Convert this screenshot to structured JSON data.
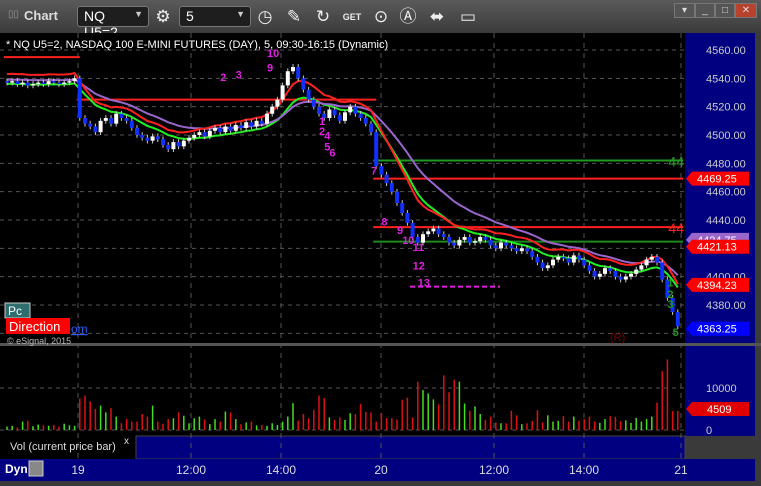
{
  "window": {
    "title": "Chart",
    "symbol": "NQ U5=2",
    "interval": "5"
  },
  "chart_header": "* NQ U5=2, NASDAQ 100 E-MINI FUTURES (DAY), 5, 09:30-16:15 (Dynamic)",
  "toolbar_icons": [
    "settings-icon",
    "clock-icon",
    "pencil-icon",
    "study-icon",
    "get-icon",
    "play-icon",
    "alert-icon",
    "link-icon",
    "comment-icon"
  ],
  "price_axis": {
    "ticks": [
      "4560.00",
      "4540.00",
      "4520.00",
      "4500.00",
      "4480.00",
      "4460.00",
      "4440.00",
      "4400.00",
      "4380.00"
    ],
    "markers": [
      {
        "text": "4469.25",
        "color": "#ff0000"
      },
      {
        "text": "4424.75",
        "color": "#9966cc"
      },
      {
        "text": "4421.13",
        "color": "#ff0000"
      },
      {
        "text": "4394.23",
        "color": "#ff0000"
      },
      {
        "text": "4363.25",
        "color": "#0000ff"
      }
    ]
  },
  "level_labels": [
    {
      "text": "44",
      "color": "#2a9a2a"
    },
    {
      "text": "44",
      "color": "#ff2020"
    }
  ],
  "overlay": {
    "pc": "Pc",
    "direction": "Direction",
    "om": "om",
    "copyright": "© eSignal, 2015",
    "r_marker": "(R)"
  },
  "volume": {
    "ticks": [
      "10000",
      "0"
    ],
    "marker": "4509",
    "panel_label": "Vol (current price bar)",
    "close": "x"
  },
  "time_axis": {
    "dyn": "Dyn",
    "labels": [
      "19",
      "12:00",
      "14:00",
      "20",
      "12:00",
      "14:00",
      "21"
    ]
  },
  "chart_data": {
    "type": "candlestick",
    "ylim": [
      4355,
      4570
    ],
    "closes": [
      4537,
      4538,
      4536,
      4537,
      4535,
      4536,
      4537,
      4536,
      4538,
      4537,
      4536,
      4537,
      4538,
      4540,
      4512,
      4508,
      4506,
      4502,
      4510,
      4512,
      4508,
      4515,
      4512,
      4510,
      4505,
      4500,
      4498,
      4496,
      4499,
      4497,
      4493,
      4490,
      4495,
      4492,
      4496,
      4498,
      4500,
      4502,
      4499,
      4503,
      4505,
      4502,
      4506,
      4503,
      4507,
      4505,
      4509,
      4506,
      4510,
      4508,
      4515,
      4520,
      4525,
      4535,
      4545,
      4548,
      4540,
      4532,
      4525,
      4520,
      4515,
      4512,
      4518,
      4514,
      4510,
      4516,
      4520,
      4515,
      4512,
      4508,
      4502,
      4478,
      4472,
      4466,
      4460,
      4452,
      4445,
      4438,
      4428,
      4424,
      4430,
      4432,
      4434,
      4430,
      4428,
      4424,
      4422,
      4426,
      4428,
      4424,
      4425,
      4428,
      4426,
      4422,
      4420,
      4424,
      4422,
      4420,
      4418,
      4420,
      4418,
      4414,
      4410,
      4406,
      4408,
      4412,
      4414,
      4413,
      4410,
      4415,
      4412,
      4408,
      4404,
      4400,
      4402,
      4406,
      4404,
      4400,
      4398,
      4400,
      4402,
      4405,
      4408,
      4412,
      4414,
      4410,
      4398,
      4385,
      4375,
      4365
    ],
    "volume": [
      800,
      1000,
      600,
      2000,
      2200,
      900,
      1300,
      1100,
      1000,
      1200,
      800,
      1500,
      1100,
      1000,
      7500,
      8200,
      6800,
      5000,
      5800,
      4200,
      5200,
      3200,
      1600,
      2600,
      2000,
      2000,
      3800,
      3200,
      5800,
      2000,
      1500,
      2600,
      2800,
      4200,
      3400,
      1600,
      2800,
      3200,
      2500,
      1400,
      2600,
      2000,
      4400,
      4200,
      2600,
      1400,
      1800,
      2000,
      1100,
      1200,
      1000,
      1600,
      1200,
      2000,
      3200,
      6400,
      2200,
      3800,
      2800,
      4800,
      8200,
      7600,
      3000,
      2400,
      3000,
      2400,
      4000,
      3800,
      6200,
      4300,
      4200,
      2000,
      4000,
      2800,
      2800,
      2500,
      7200,
      7700,
      3000,
      11500,
      9500,
      8700,
      7300,
      6100,
      13000,
      9000,
      12000,
      11500,
      6300,
      4600,
      5600,
      3800,
      2400,
      3200,
      1800,
      1600,
      1600,
      4600,
      3500,
      1400,
      1600,
      2200,
      4700,
      1800,
      3500,
      2000,
      2200,
      3300,
      2000,
      3200,
      2200,
      2600,
      3200,
      2000,
      1700,
      2600,
      3300,
      3100,
      2100,
      2300,
      1700,
      2900,
      2000,
      2600,
      3200,
      6500,
      14000,
      16800,
      4500,
      4509
    ],
    "levels": [
      {
        "price": 4555,
        "from": 0,
        "to": 14,
        "color": "#ff2020"
      },
      {
        "price": 4525,
        "from": 14,
        "to": 71,
        "color": "#ff2020"
      },
      {
        "price": 4482,
        "from": 71,
        "to": 130,
        "color": "#1f9a1f"
      },
      {
        "price": 4469.25,
        "from": 71,
        "to": 130,
        "color": "#ff2020"
      },
      {
        "price": 4435,
        "from": 71,
        "to": 130,
        "color": "#ff2020"
      },
      {
        "price": 4424.75,
        "from": 71,
        "to": 130,
        "color": "#1f8a1f"
      }
    ],
    "annotations": [
      {
        "text": "2",
        "bar": 41,
        "price": 4538,
        "color": "#e020e0"
      },
      {
        "text": "3",
        "bar": 44,
        "price": 4540,
        "color": "#e020e0"
      },
      {
        "text": "9",
        "bar": 50,
        "price": 4545,
        "color": "#e020e0"
      },
      {
        "text": "10",
        "bar": 50,
        "price": 4555,
        "color": "#e020e0"
      },
      {
        "text": "1",
        "bar": 60,
        "price": 4507,
        "color": "#e020e0"
      },
      {
        "text": "2",
        "bar": 60,
        "price": 4500,
        "color": "#e020e0"
      },
      {
        "text": "4",
        "bar": 61,
        "price": 4497,
        "color": "#e020e0"
      },
      {
        "text": "5",
        "bar": 61,
        "price": 4489,
        "color": "#e020e0"
      },
      {
        "text": "6",
        "bar": 62,
        "price": 4485,
        "color": "#e020e0"
      },
      {
        "text": "7",
        "bar": 70,
        "price": 4472,
        "color": "#e020e0"
      },
      {
        "text": "8",
        "bar": 72,
        "price": 4436,
        "color": "#e020e0"
      },
      {
        "text": "9",
        "bar": 75,
        "price": 4430,
        "color": "#e020e0"
      },
      {
        "text": "10",
        "bar": 76,
        "price": 4423,
        "color": "#e020e0"
      },
      {
        "text": "11",
        "bar": 78,
        "price": 4418,
        "color": "#e020e0"
      },
      {
        "text": "12",
        "bar": 78,
        "price": 4405,
        "color": "#e020e0"
      },
      {
        "text": "13",
        "bar": 79,
        "price": 4393,
        "color": "#e020e0"
      },
      {
        "text": "1",
        "bar": 127,
        "price": 4393,
        "color": "#1f9a1f"
      },
      {
        "text": "2",
        "bar": 127,
        "price": 4385,
        "color": "#1f9a1f"
      },
      {
        "text": "3",
        "bar": 127,
        "price": 4378,
        "color": "#1f9a1f"
      },
      {
        "text": "5",
        "bar": 128,
        "price": 4358,
        "color": "#1f9a1f"
      }
    ]
  }
}
